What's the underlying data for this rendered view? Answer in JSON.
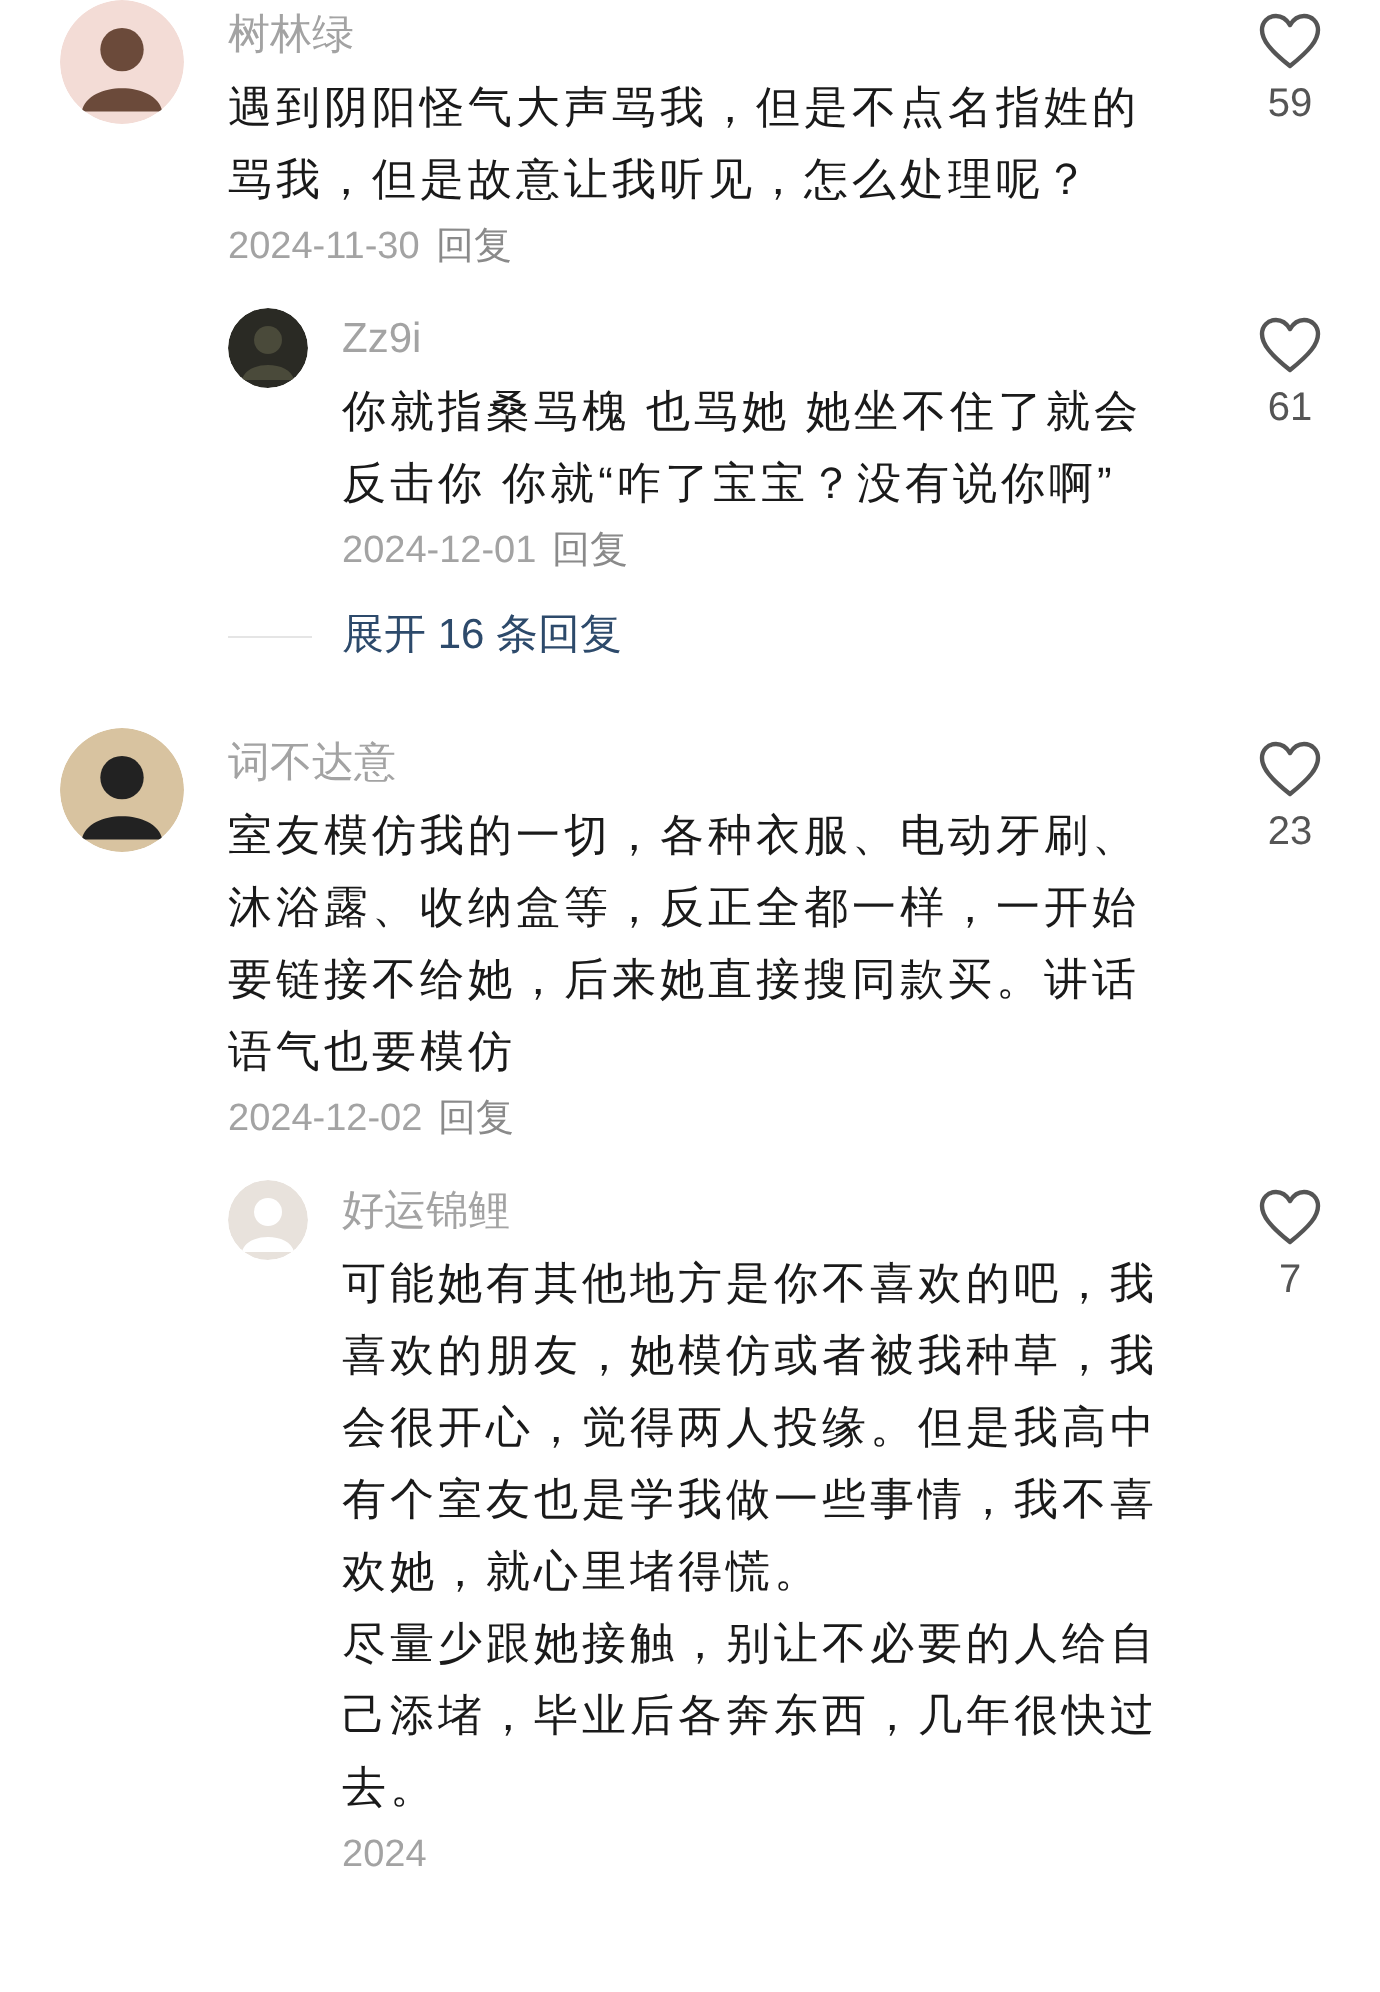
{
  "comments": [
    {
      "author": "树林绿",
      "paragraphs": [
        "遇到阴阳怪气大声骂我，但是不点名指姓的骂我，但是故意让我听见，怎么处理呢？"
      ],
      "date": "2024-11-30",
      "reply_label": "回复",
      "likes": "59",
      "replies": [
        {
          "author": "Zz9i",
          "paragraphs": [
            "你就指桑骂槐 也骂她 她坐不住了就会反击你 你就“咋了宝宝？没有说你啊”"
          ],
          "date": "2024-12-01",
          "reply_label": "回复",
          "likes": "61"
        }
      ],
      "expand_label": "展开 16 条回复"
    },
    {
      "author": "词不达意",
      "paragraphs": [
        "室友模仿我的一切，各种衣服、电动牙刷、沐浴露、收纳盒等，反正全都一样，一开始要链接不给她，后来她直接搜同款买。讲话语气也要模仿"
      ],
      "date": "2024-12-02",
      "reply_label": "回复",
      "likes": "23",
      "replies": [
        {
          "author": "好运锦鲤",
          "paragraphs": [
            "可能她有其他地方是你不喜欢的吧，我喜欢的朋友，她模仿或者被我种草，我会很开心，觉得两人投缘。但是我高中有个室友也是学我做一些事情，我不喜欢她，就心里堵得慌。",
            "尽量少跟她接触，别让不必要的人给自己添堵，毕业后各奔东西，几年很快过去。"
          ],
          "date": "2024",
          "likes": "7"
        }
      ]
    }
  ]
}
